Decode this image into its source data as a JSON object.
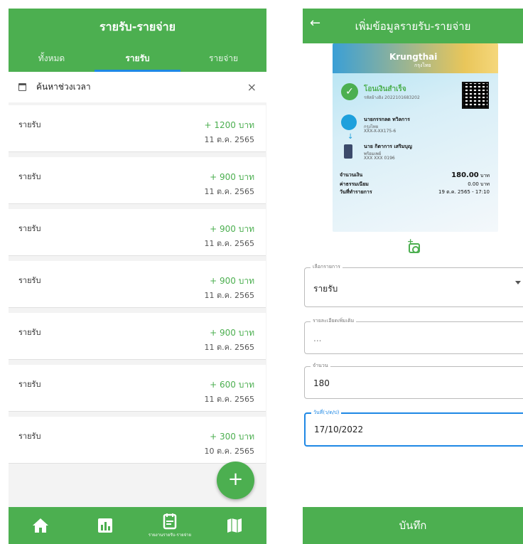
{
  "left": {
    "title": "รายรับ-รายจ่าย",
    "tabs": [
      {
        "label": "ทั้งหมด"
      },
      {
        "label": "รายรับ"
      },
      {
        "label": "รายจ่าย"
      }
    ],
    "search_label": "ค้นหาช่วงเวลา",
    "close_glyph": "×",
    "items": [
      {
        "name": "รายรับ",
        "amount": "+ 1200 บาท",
        "date": "11 ต.ค. 2565"
      },
      {
        "name": "รายรับ",
        "amount": "+ 900 บาท",
        "date": "11 ต.ค. 2565"
      },
      {
        "name": "รายรับ",
        "amount": "+ 900 บาท",
        "date": "11 ต.ค. 2565"
      },
      {
        "name": "รายรับ",
        "amount": "+ 900 บาท",
        "date": "11 ต.ค. 2565"
      },
      {
        "name": "รายรับ",
        "amount": "+ 900 บาท",
        "date": "11 ต.ค. 2565"
      },
      {
        "name": "รายรับ",
        "amount": "+ 600 บาท",
        "date": "11 ต.ค. 2565"
      },
      {
        "name": "รายรับ",
        "amount": "+ 300 บาท",
        "date": "10 ต.ค. 2565"
      }
    ],
    "fab_glyph": "+",
    "nav": [
      {
        "icon": "home-icon",
        "caption": ""
      },
      {
        "icon": "bar-chart-icon",
        "caption": ""
      },
      {
        "icon": "report-icon",
        "caption": "รายงานรายรับ-รายจ่าย"
      },
      {
        "icon": "map-icon",
        "caption": ""
      }
    ]
  },
  "right": {
    "title": "เพิ่มข้อมูลรายรับ-รายจ่าย",
    "back_glyph": "←",
    "slip": {
      "bank": "Krungthai",
      "bank_th": "กรุงไทย",
      "status": "โอนเงินสำเร็จ",
      "ref": "รหัสอ้างอิง 2022101683202",
      "sender_name": "นายกรรกลด ทวิลการ",
      "sender_bank": "กรุงไทย",
      "sender_acct": "XXX-X-XX175-6",
      "receiver_name": "นาย กิตาการ เสริมบุญ",
      "receiver_bank": "พร้อมเพย์",
      "receiver_acct": "XXX XXX 0196",
      "amount_label": "จำนวนเงิน",
      "amount_value": "180.00",
      "amount_unit": "บาท",
      "fee_label": "ค่าธรรมเนียม",
      "fee_value": "0.00 บาท",
      "datetime_label": "วันที่ทำรายการ",
      "datetime_value": "19 ต.ค. 2565 - 17:10"
    },
    "fields": {
      "type_label": "เลือกรายการ",
      "type_value": "รายรับ",
      "detail_label": "รายละเอียดเพิ่มเติม",
      "detail_value": "...",
      "amount_label": "จำนวน",
      "amount_value": "180",
      "date_label": "วันที่(ว/ด/ป)",
      "date_value": "17/10/2022"
    },
    "save_label": "บันทึก"
  },
  "colors": {
    "primary": "#4caf50",
    "accent": "#1e88e5"
  }
}
